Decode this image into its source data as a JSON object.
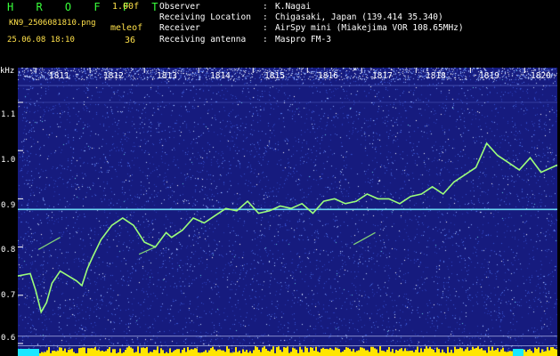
{
  "header": {
    "brand": "H R O F F T",
    "version": "1.00f",
    "filename": "KN9_2506081810.png",
    "program": "meleof",
    "datetime": "25.06.08 18:10",
    "count": "36"
  },
  "station_info": [
    {
      "key": "Observer",
      "value": "K.Nagai"
    },
    {
      "key": "Receiving Location",
      "value": "Chigasaki, Japan (139.414 35.340)"
    },
    {
      "key": "Receiver",
      "value": "AirSpy mini (Miakejima VOR 108.65MHz)"
    },
    {
      "key": "Receiving antenna",
      "value": "Maspro FM-3"
    }
  ],
  "chart_data": {
    "type": "spectrogram",
    "ylabel": "kHz",
    "y_ticks": [
      "1.1",
      "1.0",
      "0.9",
      "0.8",
      "0.7",
      "0.6"
    ],
    "y_tick_values": [
      1.1,
      1.0,
      0.9,
      0.8,
      0.7,
      0.6
    ],
    "x_ticks": [
      "1811",
      "1812",
      "1813",
      "1814",
      "1815",
      "1816",
      "1817",
      "1818",
      "1819",
      "1820"
    ],
    "x_tick_values": [
      1811,
      1812,
      1813,
      1814,
      1815,
      1816,
      1817,
      1818,
      1819,
      1820
    ],
    "xlim": [
      1810.67,
      1820.6
    ],
    "ylim": [
      0.574,
      1.172
    ],
    "carrier_khz": 0.878,
    "background": "#161b7e",
    "trace": {
      "color": "#9cff7a",
      "x": [
        1810.67,
        1810.9,
        1811.0,
        1811.1,
        1811.2,
        1811.3,
        1811.45,
        1811.6,
        1811.75,
        1811.85,
        1811.95,
        1812.05,
        1812.2,
        1812.4,
        1812.6,
        1812.8,
        1813.0,
        1813.2,
        1813.4,
        1813.5,
        1813.7,
        1813.9,
        1814.1,
        1814.3,
        1814.5,
        1814.7,
        1814.9,
        1815.1,
        1815.3,
        1815.5,
        1815.7,
        1815.9,
        1816.1,
        1816.3,
        1816.5,
        1816.7,
        1816.9,
        1817.1,
        1817.3,
        1817.5,
        1817.7,
        1817.9,
        1818.1,
        1818.3,
        1818.5,
        1818.7,
        1818.9,
        1819.1,
        1819.3,
        1819.5,
        1819.7,
        1819.9,
        1820.1,
        1820.3,
        1820.6
      ],
      "y": [
        0.74,
        0.745,
        0.71,
        0.665,
        0.685,
        0.725,
        0.75,
        0.74,
        0.73,
        0.72,
        0.755,
        0.78,
        0.815,
        0.845,
        0.86,
        0.845,
        0.81,
        0.8,
        0.83,
        0.82,
        0.835,
        0.86,
        0.85,
        0.865,
        0.88,
        0.875,
        0.895,
        0.87,
        0.875,
        0.885,
        0.88,
        0.89,
        0.87,
        0.895,
        0.9,
        0.89,
        0.895,
        0.91,
        0.9,
        0.9,
        0.89,
        0.905,
        0.91,
        0.925,
        0.91,
        0.935,
        0.95,
        0.965,
        1.015,
        0.99,
        0.975,
        0.96,
        0.985,
        0.955,
        0.97
      ]
    },
    "meteor_echoes": [
      {
        "x": [
          1811.05,
          1811.45
        ],
        "y": [
          0.795,
          0.82
        ]
      },
      {
        "x": [
          1812.9,
          1813.2
        ],
        "y": [
          0.785,
          0.8
        ]
      },
      {
        "x": [
          1816.85,
          1817.25
        ],
        "y": [
          0.805,
          0.83
        ]
      }
    ],
    "bottom_strip": {
      "cyan_ranges": [
        [
          1810.67,
          1811.05
        ],
        [
          1819.75,
          1819.95
        ]
      ],
      "yellow_color": "#ffe600",
      "cyan_color": "#19e8ff"
    }
  }
}
